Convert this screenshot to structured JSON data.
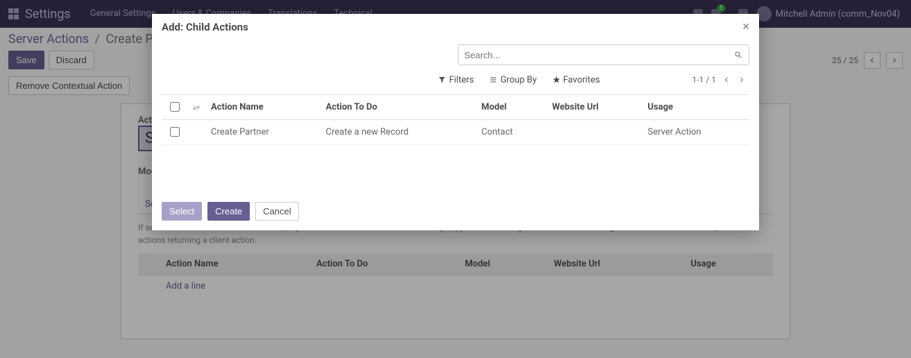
{
  "topnav": {
    "brand": "Settings",
    "menu": [
      "General Settings",
      "Users & Companies",
      "Translations",
      "Technical"
    ],
    "notification_count": "5",
    "user_display": "Mitchell Admin (comm_Nov04)"
  },
  "breadcrumb": {
    "root": "Server Actions",
    "sep": "/",
    "current": "Create Partner"
  },
  "actions": {
    "save": "Save",
    "discard": "Discard",
    "remove_ctx": "Remove Contextual Action"
  },
  "page_paging": {
    "text": "25 / 25"
  },
  "form": {
    "action_name_label": "Action Name",
    "action_name_value_prefix": "Set",
    "model_label": "Model",
    "tab_security": "Security",
    "help_text": "If several child actions return an action, only the last one will be executed. This may happen when having server actions executing code that returns an action, or server actions returning a client action.",
    "columns": {
      "action_name": "Action Name",
      "action_to_do": "Action To Do",
      "model": "Model",
      "website_url": "Website Url",
      "usage": "Usage"
    },
    "add_line": "Add a line"
  },
  "modal": {
    "title": "Add: Child Actions",
    "search_placeholder": "Search...",
    "filters_label": "Filters",
    "groupby_label": "Group By",
    "favorites_label": "Favorites",
    "pager": "1-1 / 1",
    "columns": {
      "action_name": "Action Name",
      "action_to_do": "Action To Do",
      "model": "Model",
      "website_url": "Website Url",
      "usage": "Usage"
    },
    "rows": [
      {
        "action_name": "Create Partner",
        "action_to_do": "Create a new Record",
        "model": "Contact",
        "website_url": "",
        "usage": "Server Action"
      }
    ],
    "buttons": {
      "select": "Select",
      "create": "Create",
      "cancel": "Cancel"
    },
    "close": "×"
  }
}
